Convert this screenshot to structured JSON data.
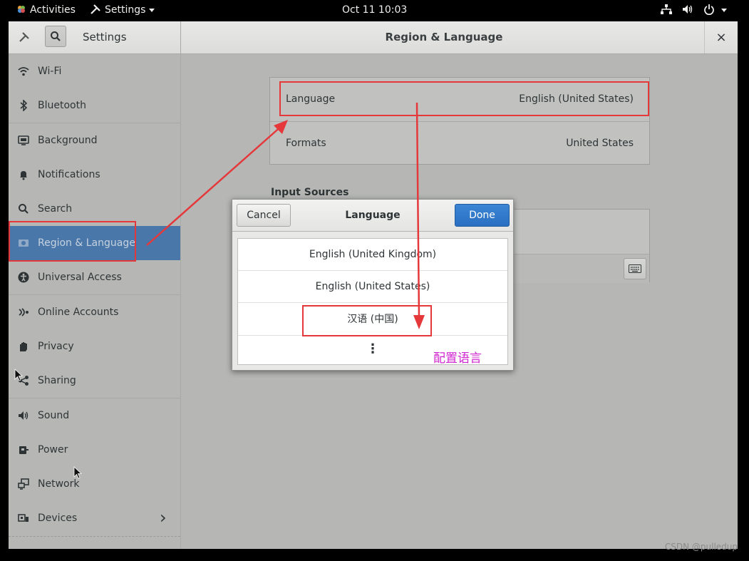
{
  "topbar": {
    "activities": "Activities",
    "app_menu": "Settings",
    "clock": "Oct 11  10:03"
  },
  "window": {
    "sidebar_title": "Settings",
    "main_title": "Region & Language",
    "close_glyph": "×"
  },
  "sidebar": {
    "items": [
      {
        "label": "Wi-Fi",
        "icon": "wifi-icon"
      },
      {
        "label": "Bluetooth",
        "icon": "bluetooth-icon"
      },
      {
        "label": "Background",
        "icon": "background-icon"
      },
      {
        "label": "Notifications",
        "icon": "bell-icon"
      },
      {
        "label": "Search",
        "icon": "search-icon"
      },
      {
        "label": "Region & Language",
        "icon": "region-icon",
        "selected": true
      },
      {
        "label": "Universal Access",
        "icon": "accessibility-icon"
      },
      {
        "label": "Online Accounts",
        "icon": "online-accounts-icon"
      },
      {
        "label": "Privacy",
        "icon": "privacy-hand-icon"
      },
      {
        "label": "Sharing",
        "icon": "share-icon"
      },
      {
        "label": "Sound",
        "icon": "speaker-icon"
      },
      {
        "label": "Power",
        "icon": "power-plug-icon"
      },
      {
        "label": "Network",
        "icon": "network-icon"
      },
      {
        "label": "Devices",
        "icon": "devices-icon"
      }
    ],
    "devices_chevron": "›"
  },
  "region": {
    "language_label": "Language",
    "language_value": "English (United States)",
    "formats_label": "Formats",
    "formats_value": "United States",
    "input_sources_label": "Input Sources"
  },
  "dialog": {
    "title": "Language",
    "cancel_label": "Cancel",
    "done_label": "Done",
    "languages": [
      "English (United Kingdom)",
      "English (United States)",
      "汉语 (中国)"
    ],
    "more_glyph": "⋮"
  },
  "annotation": {
    "note": "配置语言",
    "color": "#e5383b"
  },
  "watermark": "CSDN @pulledup"
}
